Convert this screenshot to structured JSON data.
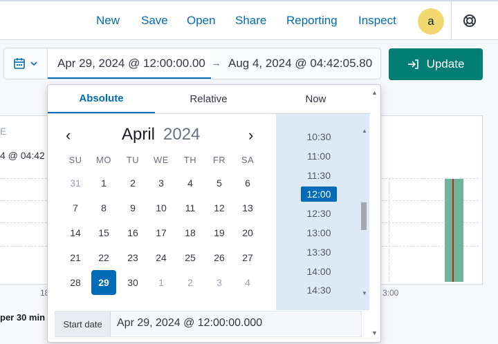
{
  "header": {
    "nav": [
      "New",
      "Save",
      "Open",
      "Share",
      "Reporting",
      "Inspect"
    ],
    "avatar_letter": "a",
    "help_icon": "lifebuoy-icon"
  },
  "background": {
    "partial_texts": [
      "E",
      "4 @ 04:42",
      "18",
      "3:00",
      "per 30 min"
    ]
  },
  "date_picker": {
    "calendar_icon": "calendar-icon",
    "start": "Apr 29, 2024 @ 12:00:00.00",
    "arrow": "→",
    "end": "Aug 4, 2024 @ 04:42:05.80"
  },
  "update_button": {
    "label": "Update",
    "icon": "refresh-arrow-icon",
    "color": "#017d73"
  },
  "popover": {
    "tabs": [
      "Absolute",
      "Relative",
      "Now"
    ],
    "active_tab": "Absolute",
    "month": "April",
    "year": "2024",
    "weekdays": [
      "SU",
      "MO",
      "TU",
      "WE",
      "TH",
      "FR",
      "SA"
    ],
    "weeks": [
      [
        "31",
        "1",
        "2",
        "3",
        "4",
        "5",
        "6"
      ],
      [
        "7",
        "8",
        "9",
        "10",
        "11",
        "12",
        "13"
      ],
      [
        "14",
        "15",
        "16",
        "17",
        "18",
        "19",
        "20"
      ],
      [
        "21",
        "22",
        "23",
        "24",
        "25",
        "26",
        "27"
      ],
      [
        "28",
        "29",
        "30",
        "1",
        "2",
        "3",
        "4"
      ]
    ],
    "selected_day": "29",
    "times": [
      "10:30",
      "11:00",
      "11:30",
      "12:00",
      "12:30",
      "13:00",
      "13:30",
      "14:00",
      "14:30"
    ],
    "selected_time": "12:00",
    "start_label": "Start date",
    "start_value": "Apr 29, 2024 @ 12:00:00.000"
  },
  "colors": {
    "accent": "#006bb8",
    "selected_bg": "#006bb8",
    "time_col_bg": "#dde9f7",
    "bar": "#6fb399",
    "marker": "#bd271e"
  }
}
